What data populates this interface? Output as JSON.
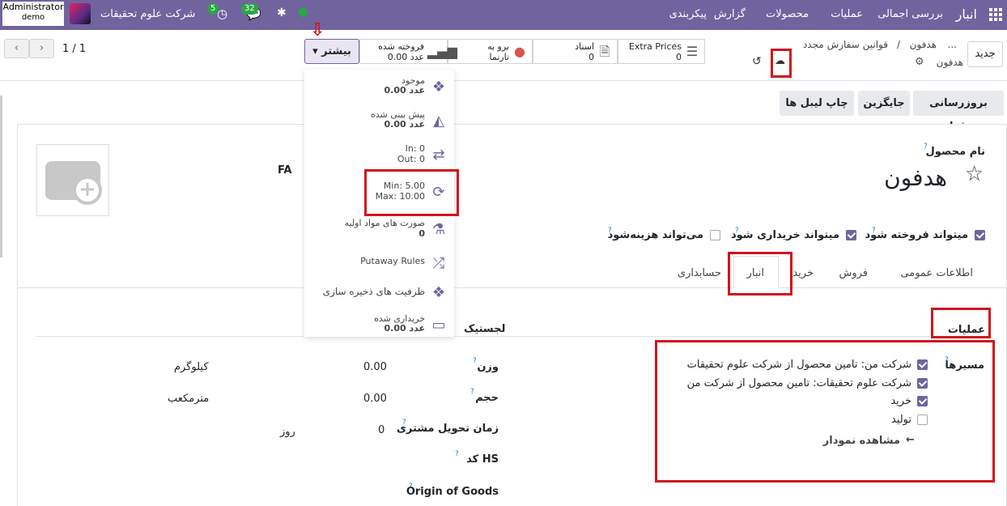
{
  "topbar": {
    "app_name": "انبار",
    "menus": [
      "بررسی اجمالی",
      "عملیات",
      "محصولات",
      "گزارش",
      "پیکربندی"
    ],
    "company": "شرکت علوم تحقیقات",
    "user_name": "Administrator",
    "db_name": "demo",
    "messages_count": "32",
    "activities_count": "5",
    "color": "#71639e"
  },
  "control": {
    "new_label": "جدید",
    "breadcrumb_more": "...",
    "breadcrumb_1": "هدفون",
    "breadcrumb_sep": "/",
    "breadcrumb_2": "قوانین سفارش مجدد",
    "record_name": "هدفون",
    "pager": "1 / 1",
    "more_label": "بیشتر"
  },
  "stat_buttons": [
    {
      "label": "Extra Prices",
      "value": "0",
      "icon": "list-icon"
    },
    {
      "label": "اسناد",
      "value": "0",
      "icon": "document-icon"
    },
    {
      "label": "برو به",
      "value": "تارنما",
      "icon": "globe-icon"
    },
    {
      "label": "فروخته شده",
      "value": "0.00 عدد",
      "icon": "bar-chart-icon"
    }
  ],
  "dropdown": [
    {
      "label": "موجود",
      "value": "0.00 عدد",
      "icon": "cubes-icon"
    },
    {
      "label": "پیش بینی شده",
      "value": "0.00 عدد",
      "icon": "area-chart-icon"
    },
    {
      "label": "In: 0",
      "value": "Out: 0",
      "icon": "exchange-icon"
    },
    {
      "label": "Min: 5.00",
      "value": "Max: 10.00",
      "icon": "refresh-icon"
    },
    {
      "label": "صورت های مواد اولیه",
      "value": "0",
      "icon": "flask-icon"
    },
    {
      "label": "Putaway Rules",
      "value": "",
      "icon": "random-icon"
    },
    {
      "label": "ظرفیت های ذخیره سازی",
      "value": "",
      "icon": "cubes-icon"
    },
    {
      "label": "خریداری شده",
      "value": "0.00 عدد",
      "icon": "credit-card-icon"
    }
  ],
  "actions": {
    "update_qty": "بروزرسانی مقدار",
    "replenish": "جایگزین",
    "print_labels": "چاپ لیبل ها"
  },
  "form": {
    "name_label": "نام محصول",
    "name_value": "هدفون",
    "lang_code": "FA",
    "can_be_sold": "میتواند فروخته شود",
    "can_be_purchased": "میتواند خریداری شود",
    "can_be_expensed": "می‌تواند هزینه‌شود",
    "help_mark": "?"
  },
  "tabs": [
    "اطلاعات عمومی",
    "فروش",
    "خرید",
    "انبار",
    "حسابداری"
  ],
  "operations": {
    "title": "عملیات",
    "routes_label": "مسیرها",
    "routes": [
      {
        "label": "شرکت من: تامین محصول از شرکت علوم تحقیقات",
        "checked": true
      },
      {
        "label": "شرکت علوم تحقیقات: تامین محصول از شرکت من",
        "checked": true
      },
      {
        "label": "خرید",
        "checked": true
      },
      {
        "label": "تولید",
        "checked": false
      }
    ],
    "diagram_link": "مشاهده نمودار"
  },
  "logistics": {
    "title": "لجستیک",
    "weight_label": "وزن",
    "weight_value": "0.00",
    "weight_unit": "کیلوگرم",
    "volume_label": "حجم",
    "volume_value": "0.00",
    "volume_unit": "مترمکعب",
    "lead_label": "زمان تحویل مشتری",
    "lead_value": "0",
    "lead_unit": "روز",
    "hs_label": "کد HS",
    "origin_label": "Origin of Goods"
  }
}
